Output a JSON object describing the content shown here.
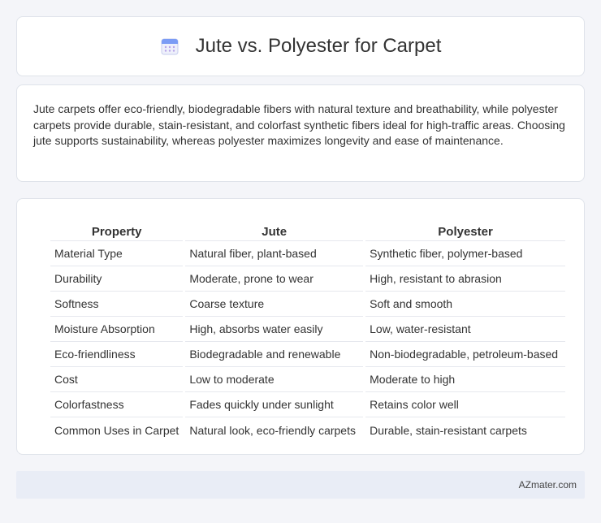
{
  "header": {
    "title": "Jute vs. Polyester for Carpet",
    "icon": "calendar-icon",
    "accent": "#6c8ef5"
  },
  "intro": {
    "text": "Jute carpets offer eco-friendly, biodegradable fibers with natural texture and breathability, while polyester carpets provide durable, stain-resistant, and colorfast synthetic fibers ideal for high-traffic areas. Choosing jute supports sustainability, whereas polyester maximizes longevity and ease of maintenance."
  },
  "table": {
    "headers": [
      "Property",
      "Jute",
      "Polyester"
    ],
    "rows": [
      [
        "Material Type",
        "Natural fiber, plant-based",
        "Synthetic fiber, polymer-based"
      ],
      [
        "Durability",
        "Moderate, prone to wear",
        "High, resistant to abrasion"
      ],
      [
        "Softness",
        "Coarse texture",
        "Soft and smooth"
      ],
      [
        "Moisture Absorption",
        "High, absorbs water easily",
        "Low, water-resistant"
      ],
      [
        "Eco-friendliness",
        "Biodegradable and renewable",
        "Non-biodegradable, petroleum-based"
      ],
      [
        "Cost",
        "Low to moderate",
        "Moderate to high"
      ],
      [
        "Colorfastness",
        "Fades quickly under sunlight",
        "Retains color well"
      ],
      [
        "Common Uses in Carpet",
        "Natural look, eco-friendly carpets",
        "Durable, stain-resistant carpets"
      ]
    ]
  },
  "footer": {
    "text": "AZmater.com"
  }
}
